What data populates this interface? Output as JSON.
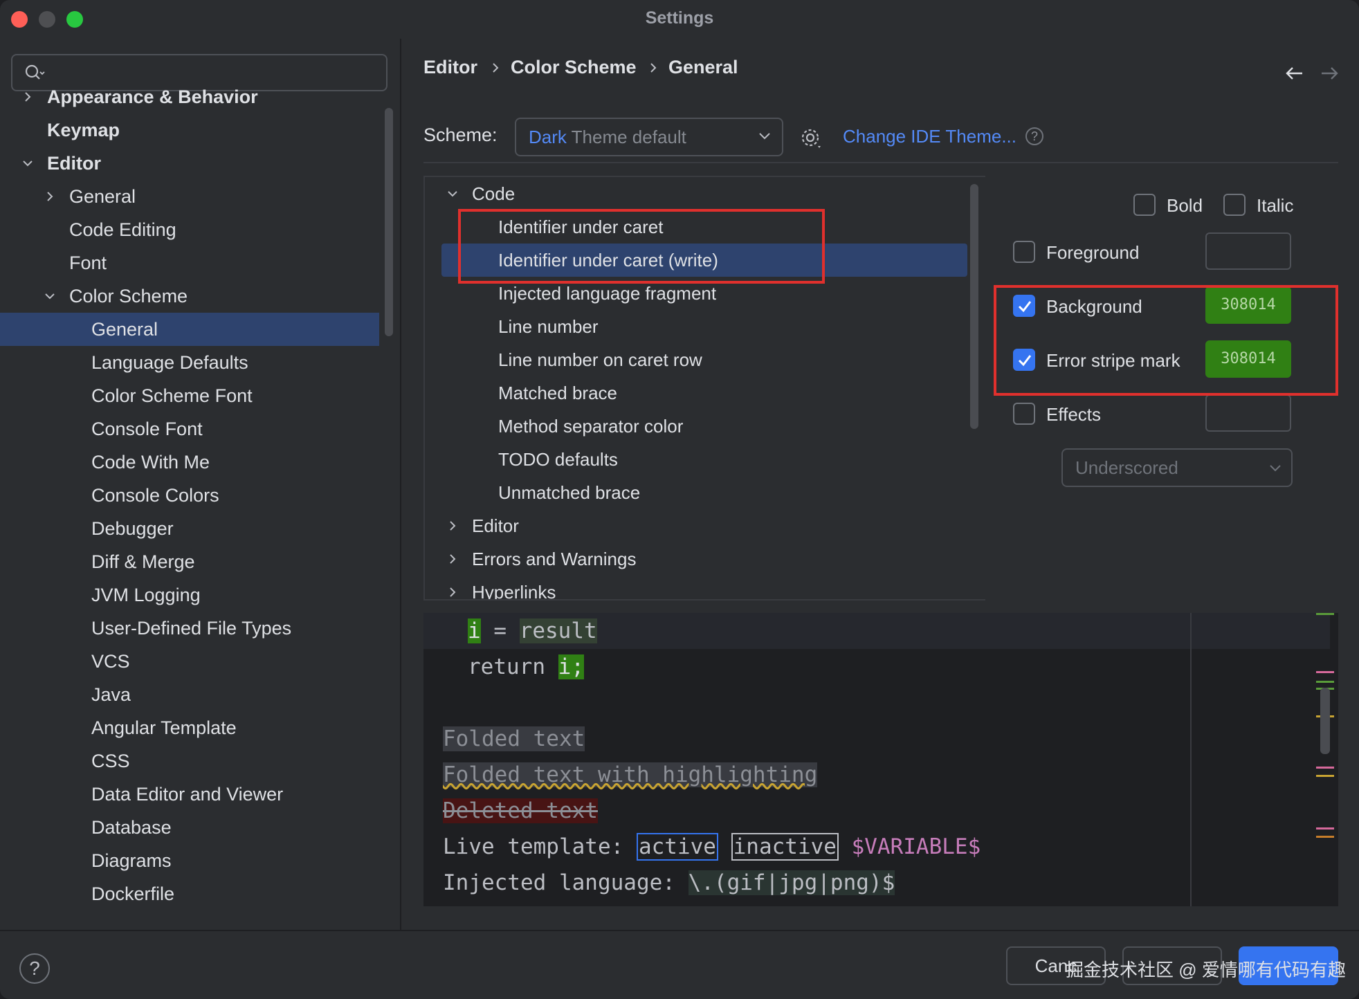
{
  "window": {
    "title": "Settings"
  },
  "search": {
    "placeholder": ""
  },
  "sidebar": {
    "items": [
      {
        "label": "Appearance & Behavior"
      },
      {
        "label": "Keymap"
      },
      {
        "label": "Editor"
      },
      {
        "label": "General"
      },
      {
        "label": "Code Editing"
      },
      {
        "label": "Font"
      },
      {
        "label": "Color Scheme"
      },
      {
        "label": "General"
      },
      {
        "label": "Language Defaults"
      },
      {
        "label": "Color Scheme Font"
      },
      {
        "label": "Console Font"
      },
      {
        "label": "Code With Me"
      },
      {
        "label": "Console Colors"
      },
      {
        "label": "Debugger"
      },
      {
        "label": "Diff & Merge"
      },
      {
        "label": "JVM Logging"
      },
      {
        "label": "User-Defined File Types"
      },
      {
        "label": "VCS"
      },
      {
        "label": "Java"
      },
      {
        "label": "Angular Template"
      },
      {
        "label": "CSS"
      },
      {
        "label": "Data Editor and Viewer"
      },
      {
        "label": "Database"
      },
      {
        "label": "Diagrams"
      },
      {
        "label": "Dockerfile"
      }
    ]
  },
  "breadcrumb": [
    "Editor",
    "Color Scheme",
    "General"
  ],
  "scheme": {
    "label": "Scheme:",
    "value_accent": "Dark",
    "value_rest": " Theme default",
    "change_theme_link": "Change IDE Theme...",
    "help_glyph": "?"
  },
  "attributes_tree": {
    "groups": [
      {
        "label": "Code"
      },
      {
        "label": "Editor"
      },
      {
        "label": "Errors and Warnings"
      },
      {
        "label": "Hyperlinks"
      }
    ],
    "code_children": [
      {
        "label": "Identifier under caret"
      },
      {
        "label": "Identifier under caret (write)"
      },
      {
        "label": "Injected language fragment"
      },
      {
        "label": "Line number"
      },
      {
        "label": "Line number on caret row"
      },
      {
        "label": "Matched brace"
      },
      {
        "label": "Method separator color"
      },
      {
        "label": "TODO defaults"
      },
      {
        "label": "Unmatched brace"
      }
    ],
    "selected": "Identifier under caret (write)"
  },
  "attributes": {
    "bold": {
      "label": "Bold",
      "checked": false
    },
    "italic": {
      "label": "Italic",
      "checked": false
    },
    "foreground": {
      "label": "Foreground",
      "checked": false,
      "color": ""
    },
    "background": {
      "label": "Background",
      "checked": true,
      "color": "308014"
    },
    "error_stripe": {
      "label": "Error stripe mark",
      "checked": true,
      "color": "308014"
    },
    "effects": {
      "label": "Effects",
      "checked": false,
      "style": "Underscored"
    }
  },
  "preview": {
    "line1": {
      "var": "i",
      "op": " = ",
      "rhs": "result"
    },
    "line2": {
      "kw": "return ",
      "var": "i;"
    },
    "folded": "Folded text",
    "folded_hl": "Folded text with highlighting",
    "deleted": "Deleted text",
    "live_template": {
      "prefix": "Live template: ",
      "active": "active",
      "inactive": "inactive",
      "variable": "$VARIABLE$"
    },
    "injected": {
      "prefix": "Injected language: ",
      "value": "\\.(gif|jpg|png)$"
    }
  },
  "footer": {
    "help_glyph": "?",
    "cancel": "Canc",
    "apply": "",
    "ok": "",
    "watermark": "掘金技术社区 @ 爱情哪有代码有趣"
  },
  "colors": {
    "accent": "#3574f0",
    "selection": "#2e436e",
    "highlight_green": "#308014",
    "annotation_red": "#e0302d"
  }
}
